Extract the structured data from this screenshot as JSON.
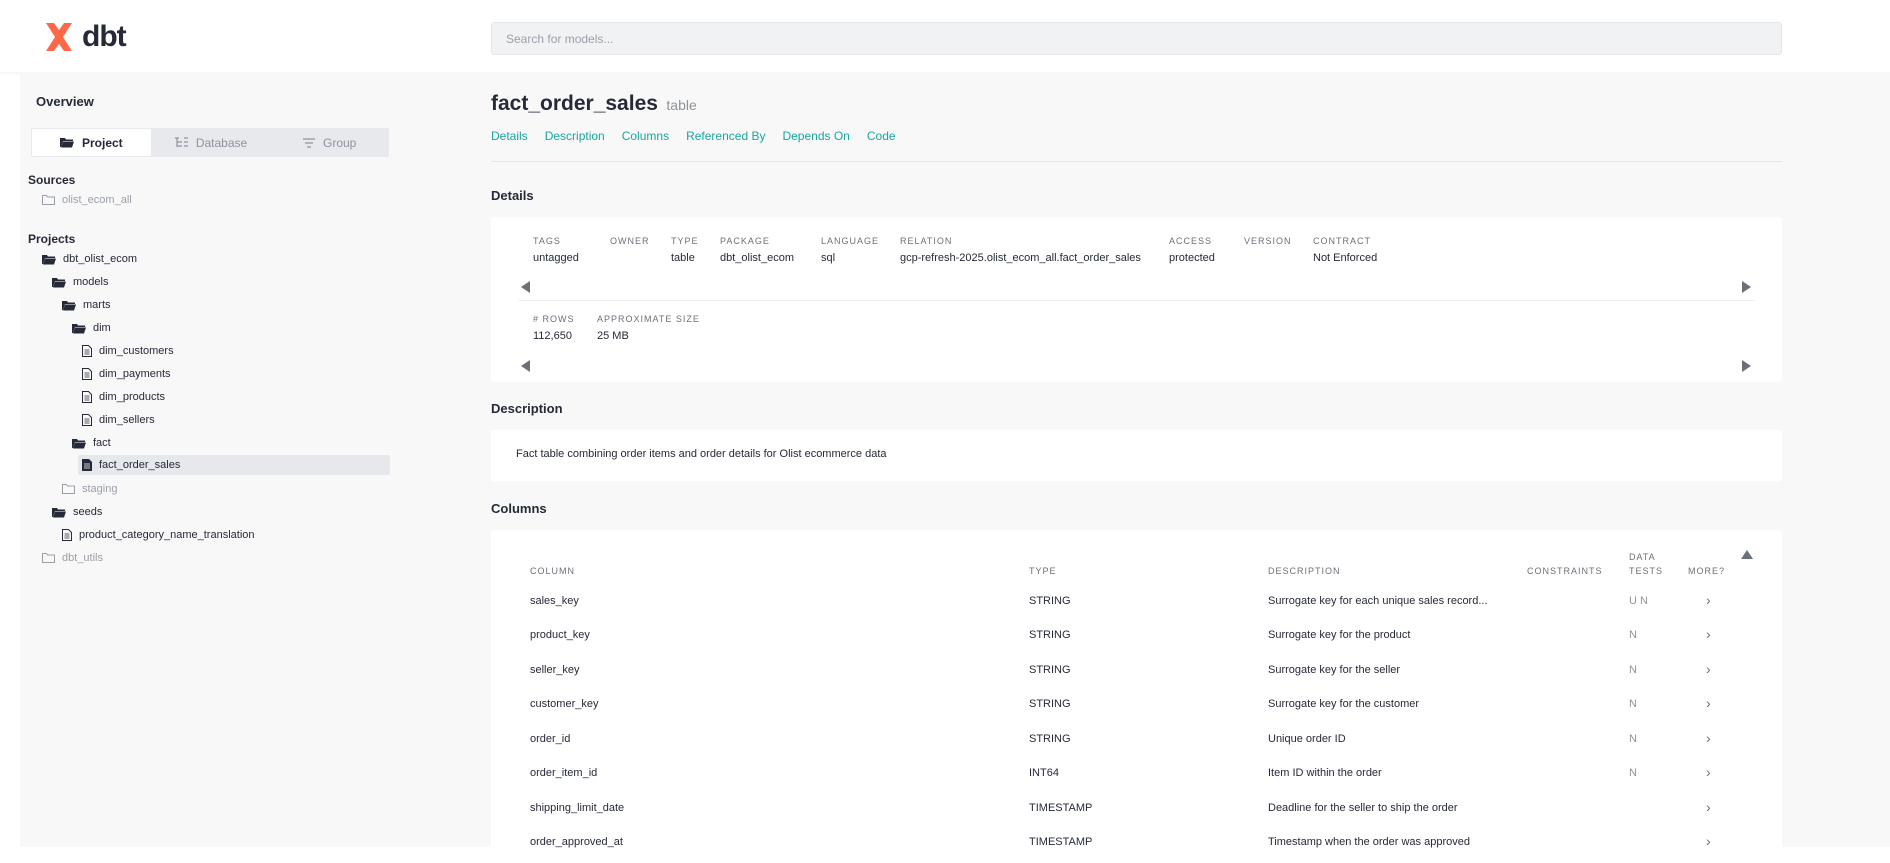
{
  "app": {
    "name": "dbt",
    "search_placeholder": "Search for models..."
  },
  "sidebar": {
    "overview": "Overview",
    "tabs": [
      {
        "label": "Project"
      },
      {
        "label": "Database"
      },
      {
        "label": "Group"
      }
    ],
    "sources_label": "Sources",
    "sources": [
      {
        "label": "olist_ecom_all"
      }
    ],
    "projects_label": "Projects",
    "tree": [
      {
        "label": "dbt_olist_ecom"
      },
      {
        "label": "models"
      },
      {
        "label": "marts"
      },
      {
        "label": "dim"
      },
      {
        "label": "dim_customers"
      },
      {
        "label": "dim_payments"
      },
      {
        "label": "dim_products"
      },
      {
        "label": "dim_sellers"
      },
      {
        "label": "fact"
      },
      {
        "label": "fact_order_sales"
      },
      {
        "label": "staging"
      },
      {
        "label": "seeds"
      },
      {
        "label": "product_category_name_translation"
      },
      {
        "label": "dbt_utils"
      }
    ]
  },
  "model": {
    "name": "fact_order_sales",
    "type": "table",
    "nav": [
      "Details",
      "Description",
      "Columns",
      "Referenced By",
      "Depends On",
      "Code"
    ]
  },
  "details": {
    "heading": "Details",
    "meta1": [
      {
        "key": "TAGS",
        "value": "untagged"
      },
      {
        "key": "OWNER",
        "value": ""
      },
      {
        "key": "TYPE",
        "value": "table"
      },
      {
        "key": "PACKAGE",
        "value": "dbt_olist_ecom"
      },
      {
        "key": "LANGUAGE",
        "value": "sql"
      },
      {
        "key": "RELATION",
        "value": "gcp-refresh-2025.olist_ecom_all.fact_order_sales"
      },
      {
        "key": "ACCESS",
        "value": "protected"
      },
      {
        "key": "VERSION",
        "value": ""
      },
      {
        "key": "CONTRACT",
        "value": "Not Enforced"
      }
    ],
    "meta2": [
      {
        "key": "# ROWS",
        "value": "112,650"
      },
      {
        "key": "APPROXIMATE SIZE",
        "value": "25 MB"
      }
    ]
  },
  "description": {
    "heading": "Description",
    "text": "Fact table combining order items and order details for Olist ecommerce data"
  },
  "columns": {
    "heading": "Columns",
    "headers": {
      "column": "COLUMN",
      "type": "TYPE",
      "description": "DESCRIPTION",
      "constraints": "CONSTRAINTS",
      "tests1": "DATA",
      "tests2": "TESTS",
      "more": "MORE?"
    },
    "more_glyph": "›",
    "rows": [
      {
        "name": "sales_key",
        "type": "STRING",
        "description": "Surrogate key for each unique sales record...",
        "tests": "U N"
      },
      {
        "name": "product_key",
        "type": "STRING",
        "description": "Surrogate key for the product",
        "tests": "N"
      },
      {
        "name": "seller_key",
        "type": "STRING",
        "description": "Surrogate key for the seller",
        "tests": "N"
      },
      {
        "name": "customer_key",
        "type": "STRING",
        "description": "Surrogate key for the customer",
        "tests": "N"
      },
      {
        "name": "order_id",
        "type": "STRING",
        "description": "Unique order ID",
        "tests": "N"
      },
      {
        "name": "order_item_id",
        "type": "INT64",
        "description": "Item ID within the order",
        "tests": "N"
      },
      {
        "name": "shipping_limit_date",
        "type": "TIMESTAMP",
        "description": "Deadline for the seller to ship the order",
        "tests": ""
      },
      {
        "name": "order_approved_at",
        "type": "TIMESTAMP",
        "description": "Timestamp when the order was approved",
        "tests": ""
      }
    ]
  }
}
